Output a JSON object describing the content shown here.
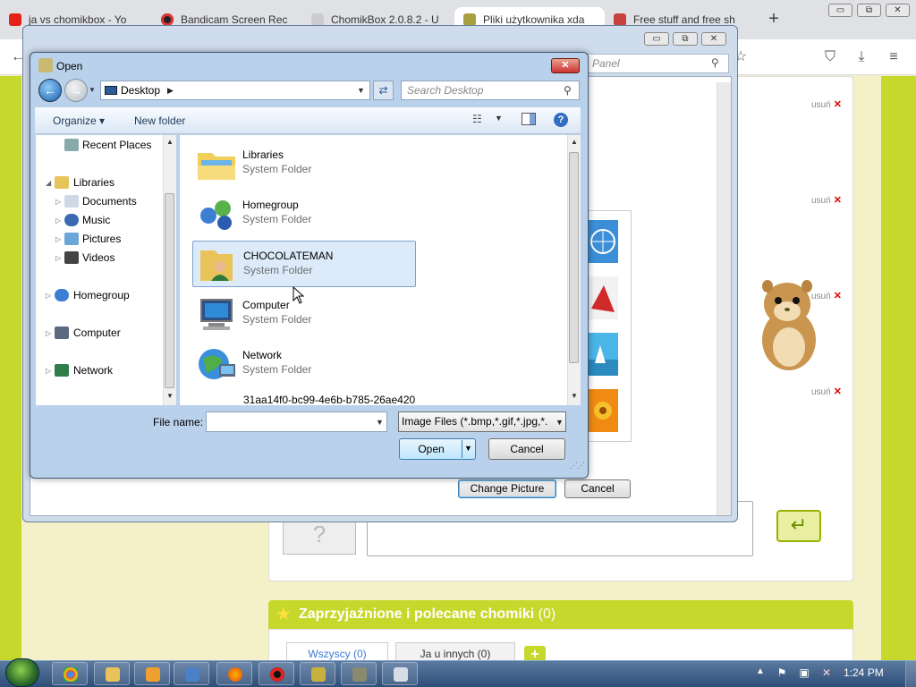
{
  "browser": {
    "tabs": [
      {
        "label": "ja vs chomikbox - Yo",
        "color": "#e62117"
      },
      {
        "label": "Bandicam Screen Rec",
        "color": "#222222"
      },
      {
        "label": "ChomikBox 2.0.8.2 - U",
        "color": "#888888"
      },
      {
        "label": "Pliki użytkownika xda",
        "color": "#a8a040"
      },
      {
        "label": "Free stuff and free sh",
        "color": "#c94040"
      }
    ],
    "window_buttons": {
      "minimize": "▭",
      "restore": "⧉",
      "close": "✕"
    },
    "toolbar_icons": [
      "back-arrow-icon",
      "star-icon",
      "pocket-icon",
      "download-icon",
      "menu-icon"
    ]
  },
  "page": {
    "usun_label": "usuń",
    "usun_x": "✕",
    "friends_title": "Zaprzyjaźnione i polecane chomiki",
    "friends_count": "(0)",
    "tab_all": "Wszyscy (0)",
    "tab_me": "Ja u innych (0)",
    "avatar_placeholder": "?",
    "send_arrow": "↵",
    "plus": "+"
  },
  "bg_dialog": {
    "search_placeholder": "Panel",
    "change_picture": "Change Picture",
    "cancel": "Cancel"
  },
  "open_dialog": {
    "title": "Open",
    "close": "✕",
    "address": "Desktop",
    "search_placeholder": "Search Desktop",
    "organize": "Organize",
    "new_folder": "New folder",
    "help": "?",
    "nav": {
      "recent_places": "Recent Places",
      "libraries": "Libraries",
      "documents": "Documents",
      "music": "Music",
      "pictures": "Pictures",
      "videos": "Videos",
      "homegroup": "Homegroup",
      "computer": "Computer",
      "network": "Network"
    },
    "files": [
      {
        "name": "Libraries",
        "type": "System Folder"
      },
      {
        "name": "Homegroup",
        "type": "System Folder"
      },
      {
        "name": "CHOCOLATEMAN",
        "type": "System Folder"
      },
      {
        "name": "Computer",
        "type": "System Folder"
      },
      {
        "name": "Network",
        "type": "System Folder"
      }
    ],
    "extra_file": "31aa14f0-bc99-4e6b-b785-26ae420",
    "file_name_label": "File name:",
    "file_name_value": "",
    "file_type": "Image Files (*.bmp,*.gif,*.jpg,*.",
    "open_button": "Open",
    "cancel_button": "Cancel"
  },
  "taskbar": {
    "clock": "1:24 PM",
    "tray_up": "▲"
  },
  "colors": {
    "lime": "#c6d82c",
    "page_bg": "#f4f1c8",
    "selection": "#dceaf9"
  }
}
